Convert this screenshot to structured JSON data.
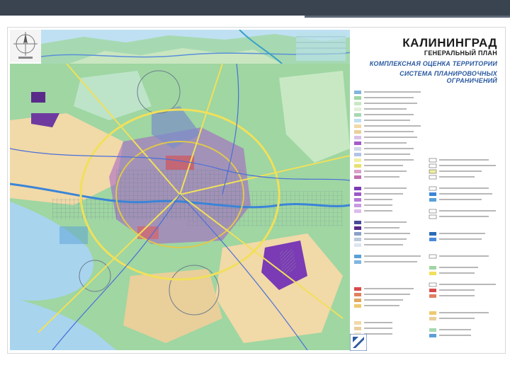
{
  "map": {
    "title": "КАЛИНИНГРАД",
    "subtitle": "ГЕНЕРАЛЬНЫЙ ПЛАН",
    "heading_line1": "КОМПЛЕКСНАЯ ОЦЕНКА ТЕРРИТОРИИ",
    "heading_line2": "СИСТЕМА ПЛАНИРОВОЧНЫХ ОГРАНИЧЕНИЙ"
  },
  "colors": {
    "top_bar": "#3a4350",
    "water": "#a8d4ee",
    "land_green": "#9fd6a2",
    "land_tan": "#f1d9a8",
    "urban_purple": "#a45bc9",
    "title_blue": "#2b5aa0"
  },
  "icons": [
    "compass-rose-icon",
    "publisher-logo-icon"
  ]
}
